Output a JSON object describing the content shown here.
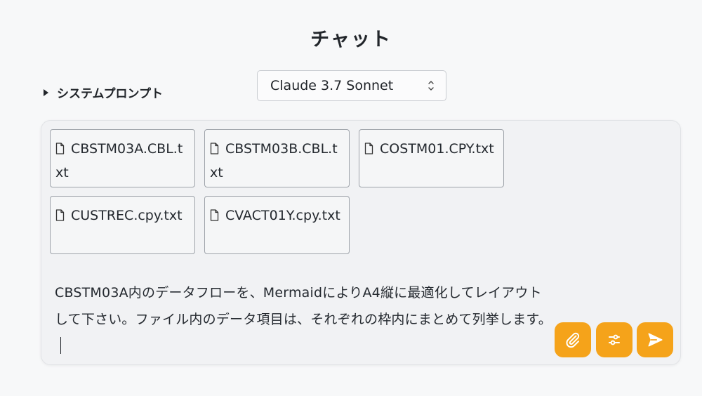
{
  "page": {
    "title": "チャット"
  },
  "system_prompt": {
    "label": "システムプロンプト"
  },
  "model_select": {
    "selected": "Claude 3.7 Sonnet"
  },
  "attachments": [
    {
      "name": "CBSTM03A.CBL.txt"
    },
    {
      "name": "CBSTM03B.CBL.txt"
    },
    {
      "name": "COSTM01.CPY.txt"
    },
    {
      "name": "CUSTREC.cpy.txt"
    },
    {
      "name": "CVACT01Y.cpy.txt"
    }
  ],
  "composer": {
    "message": "CBSTM03A内のデータフローを、MermaidによりA4縦に最適化してレイアウトして下さい。ファイル内のデータ項目は、それぞれの枠内にまとめて列挙します。"
  },
  "actions": {
    "attach_icon": "paperclip-icon",
    "settings_icon": "sliders-icon",
    "send_icon": "send-icon"
  },
  "colors": {
    "accent": "#f5a31a",
    "background": "#f7f8f9",
    "composer_bg": "#f1f2f4"
  }
}
